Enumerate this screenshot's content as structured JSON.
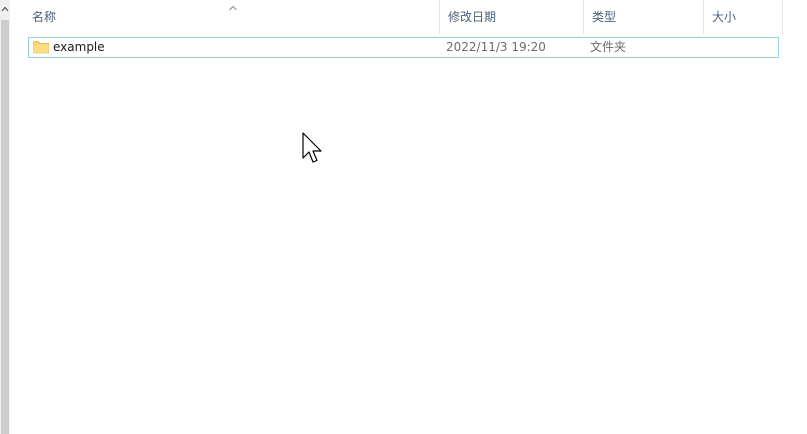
{
  "columns": {
    "name": "名称",
    "date_modified": "修改日期",
    "type": "类型",
    "size": "大小",
    "sort_column": "name",
    "sort_icon": "chevron-up-icon"
  },
  "files": [
    {
      "name": "example",
      "date_modified": "2022/11/3 19:20",
      "type": "文件夹",
      "size": "",
      "icon": "folder-icon"
    }
  ],
  "colors": {
    "row_border": "#99d1e6",
    "folder": "#f7d26b",
    "header_text": "#4c607a",
    "scrollbar_thumb": "#cdcdcd"
  }
}
